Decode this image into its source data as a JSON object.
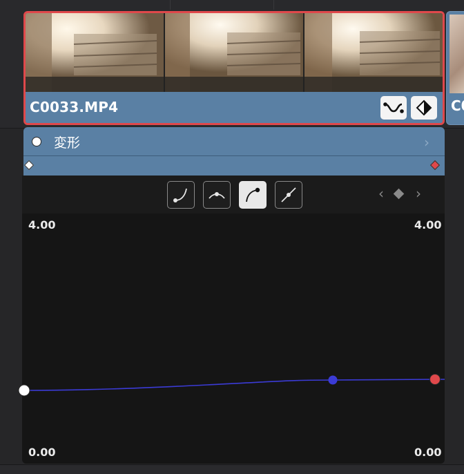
{
  "clip": {
    "name": "C0033.MP4",
    "next_clip_name": "C0",
    "border_color": "#e0484b",
    "footer_color": "#5a80a4",
    "buttons": [
      {
        "icon": "curve-editor-icon"
      },
      {
        "icon": "keyframe-icon"
      }
    ]
  },
  "keyframe_track": {
    "label": "変形",
    "expand_icon": "chevron-right-icon",
    "start_keyframe_color": "#ffffff",
    "end_keyframe_color": "#e0484b"
  },
  "curve_editor": {
    "interp_buttons": [
      {
        "icon": "ease-in-curve-icon",
        "active": false
      },
      {
        "icon": "ease-peak-curve-icon",
        "active": false
      },
      {
        "icon": "ease-out-curve-icon",
        "active": true
      },
      {
        "icon": "linear-curve-icon",
        "active": false
      }
    ],
    "nav": {
      "prev_icon": "chevron-left-icon",
      "keyframe_icon": "diamond-icon",
      "next_icon": "chevron-right-icon"
    },
    "top_left_value": "4.00",
    "top_right_value": "4.00",
    "bottom_left_value": "0.00",
    "bottom_right_value": "0.00",
    "curve_color": "#3b3bd6",
    "points": [
      {
        "name": "start-point",
        "color": "#ffffff"
      },
      {
        "name": "mid-point",
        "color": "#3b3bd6"
      },
      {
        "name": "end-point",
        "color": "#e0484b"
      }
    ]
  }
}
